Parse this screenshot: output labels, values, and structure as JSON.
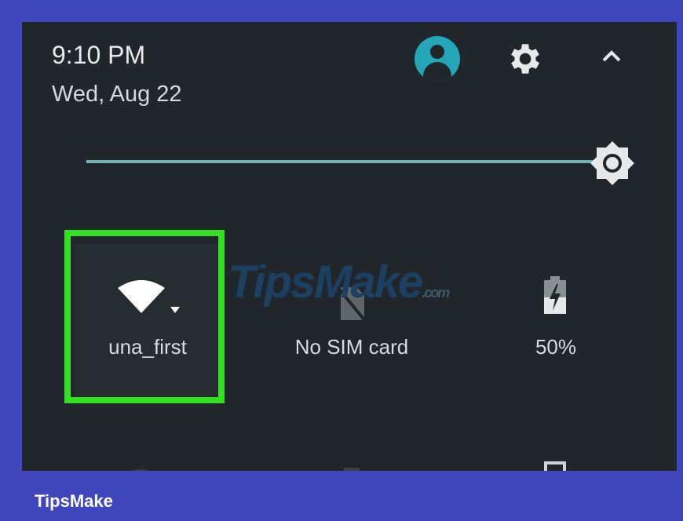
{
  "status": {
    "time": "9:10 PM",
    "date": "Wed, Aug 22"
  },
  "header_icons": [
    "account-icon",
    "gear-icon",
    "chevron-up-icon"
  ],
  "brightness": {
    "level": 1.0
  },
  "tiles": [
    {
      "label": "una_first",
      "icon": "wifi-icon"
    },
    {
      "label": "No SIM card",
      "icon": "no-sim-icon"
    },
    {
      "label": "50%",
      "icon": "battery-icon"
    }
  ],
  "watermark": {
    "text_main": "TipsMake",
    "text_suffix": ".com"
  },
  "footer": {
    "brand": "TipsMake"
  },
  "colors": {
    "panel": "#20262a",
    "accent": "#22a6b8",
    "highlight": "#35e024",
    "frame": "#4046bb"
  }
}
